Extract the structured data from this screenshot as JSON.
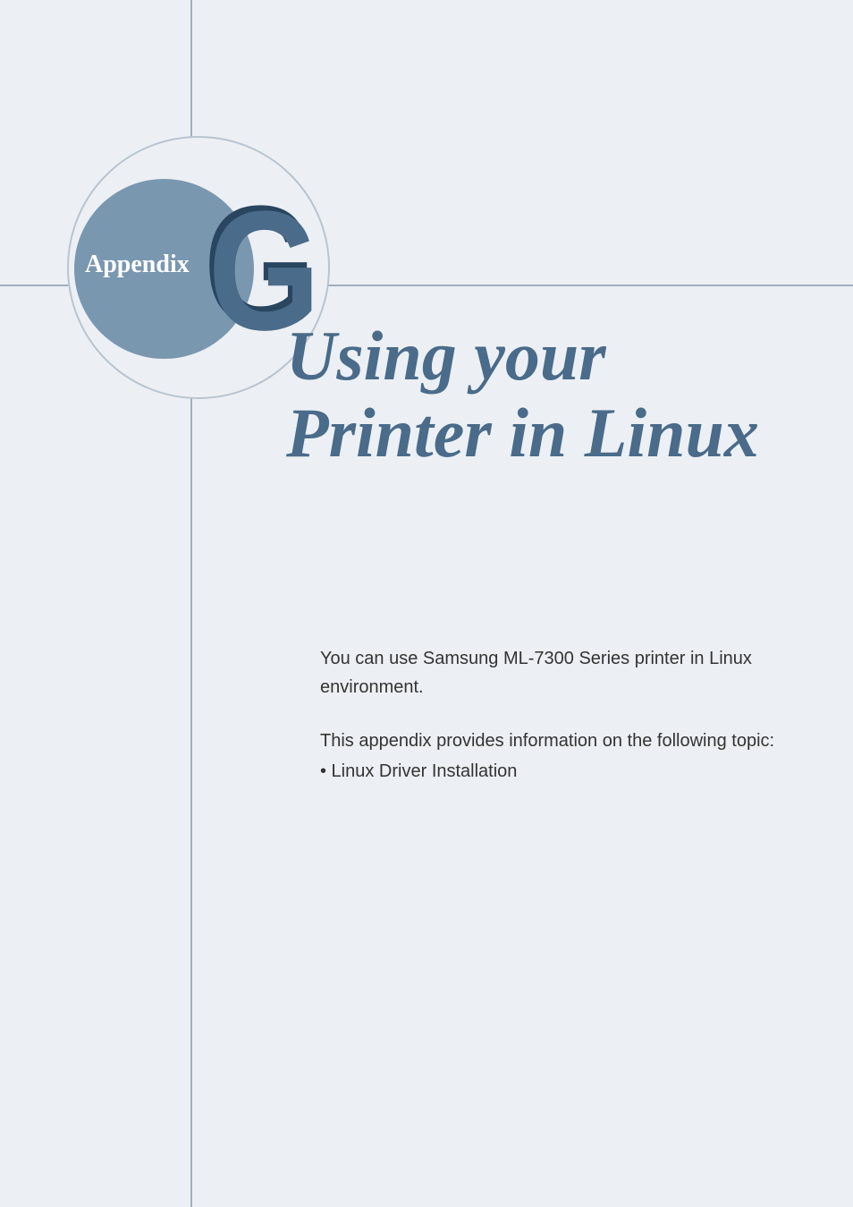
{
  "appendix": {
    "label": "Appendix",
    "letter": "G"
  },
  "title": {
    "line1": "Using your",
    "line2": "Printer in Linux"
  },
  "body": {
    "para1": "You can use Samsung ML-7300 Series printer in Linux environment.",
    "para2": "This appendix provides information on the following topic:",
    "bullet1": "• Linux Driver Installation"
  }
}
